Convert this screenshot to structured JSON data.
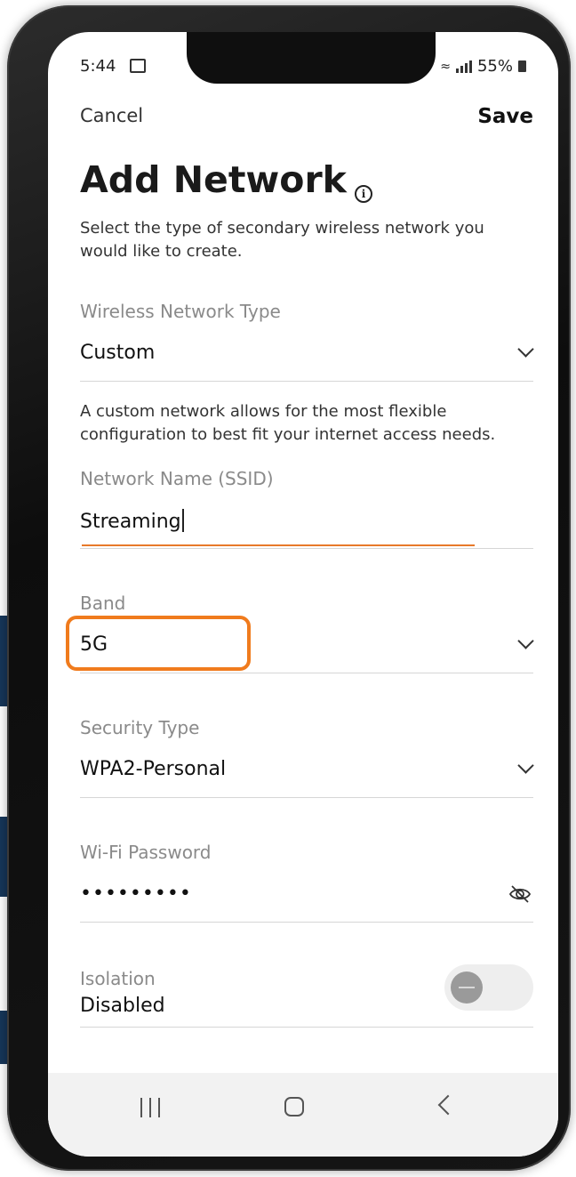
{
  "status_bar": {
    "time": "5:44",
    "battery": "55%",
    "icons": [
      "gallery-icon",
      "wifi-calling-icon",
      "signal-icon",
      "battery-icon"
    ]
  },
  "header": {
    "cancel_label": "Cancel",
    "save_label": "Save"
  },
  "page": {
    "title": "Add Network",
    "info_icon": "i",
    "subtitle": "Select the type of secondary wireless network you would like to create."
  },
  "form": {
    "network_type": {
      "label": "Wireless Network Type",
      "value": "Custom",
      "description": "A custom network allows for the most flexible configuration to best fit your internet access needs."
    },
    "ssid": {
      "label": "Network Name (SSID)",
      "value": "Streaming"
    },
    "band": {
      "label": "Band",
      "value": "5G"
    },
    "security": {
      "label": "Security Type",
      "value": "WPA2-Personal"
    },
    "password": {
      "label": "Wi-Fi Password",
      "value": "•••••••••"
    },
    "isolation": {
      "label": "Isolation",
      "value": "Disabled",
      "enabled": false
    }
  },
  "colors": {
    "accent": "#f07b1d",
    "text_primary": "#111111",
    "text_label": "#8a8a8a",
    "background_bar": "#163659"
  },
  "nav": {
    "icons": [
      "recent-apps-icon",
      "home-icon",
      "back-icon"
    ]
  }
}
